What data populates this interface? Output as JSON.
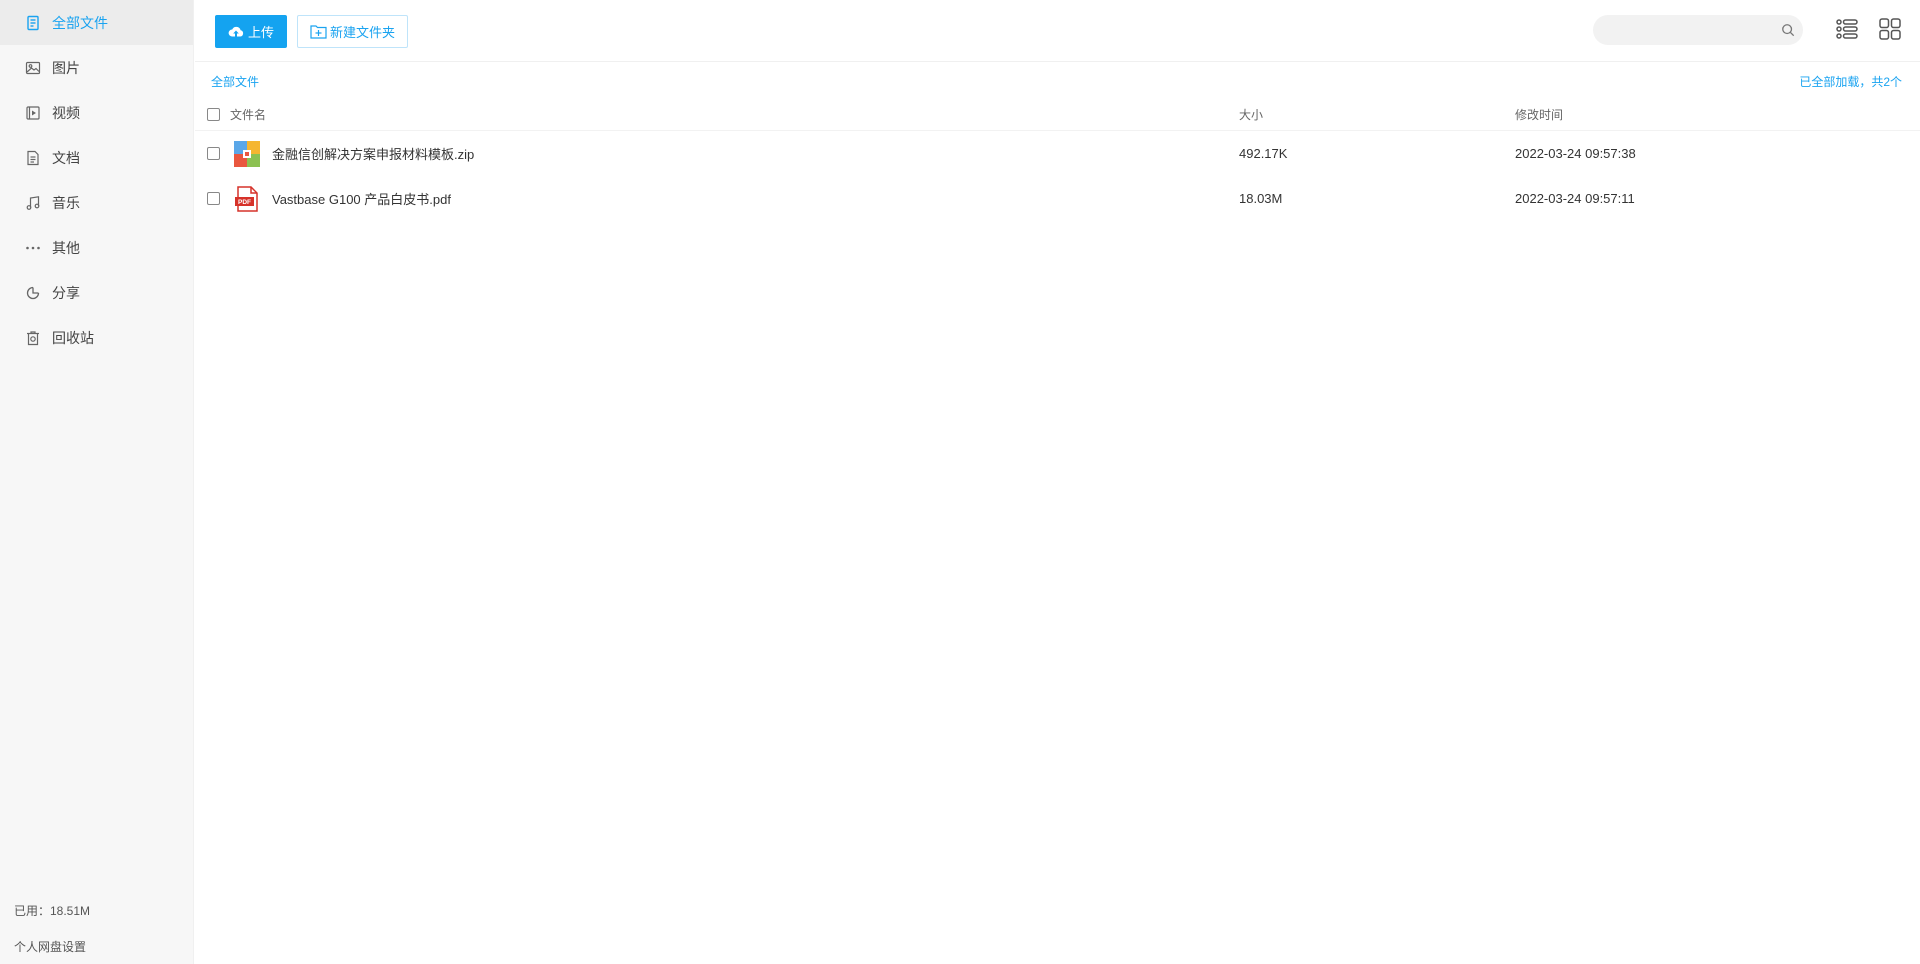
{
  "sidebar": {
    "items": [
      {
        "label": "全部文件",
        "icon": "all-files-icon",
        "active": true
      },
      {
        "label": "图片",
        "icon": "image-icon"
      },
      {
        "label": "视频",
        "icon": "video-icon"
      },
      {
        "label": "文档",
        "icon": "document-icon"
      },
      {
        "label": "音乐",
        "icon": "music-icon"
      },
      {
        "label": "其他",
        "icon": "more-icon"
      },
      {
        "label": "分享",
        "icon": "share-icon"
      },
      {
        "label": "回收站",
        "icon": "recycle-bin-icon"
      }
    ],
    "used": "已用：18.51M",
    "settings": "个人网盘设置"
  },
  "toolbar": {
    "upload_label": "上传",
    "new_folder_label": "新建文件夹",
    "search_placeholder": ""
  },
  "breadcrumb": "全部文件",
  "loaded_status": "已全部加载，共2个",
  "table": {
    "headers": {
      "name": "文件名",
      "size": "大小",
      "time": "修改时间"
    },
    "rows": [
      {
        "name": "金融信创解决方案申报材料模板.zip",
        "size": "492.17K",
        "time": "2022-03-24 09:57:38",
        "type": "zip-icon"
      },
      {
        "name": "Vastbase G100 产品白皮书.pdf",
        "size": "18.03M",
        "time": "2022-03-24 09:57:11",
        "type": "pdf-icon"
      }
    ]
  },
  "colors": {
    "accent": "#14a3f0",
    "sidebar_bg": "#f7f7f7",
    "active_bg": "#ececec"
  }
}
